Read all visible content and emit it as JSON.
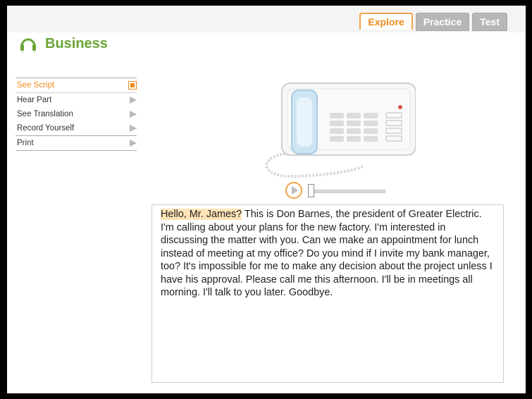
{
  "tabs": [
    {
      "label": "Explore",
      "active": true
    },
    {
      "label": "Practice",
      "active": false
    },
    {
      "label": "Test",
      "active": false
    }
  ],
  "header": {
    "title": "Business",
    "icon": "headphones-icon"
  },
  "menu": {
    "items": [
      {
        "label": "See Script",
        "icon": "stop-icon"
      },
      {
        "label": "Hear Part",
        "icon": "arrow-right-icon"
      },
      {
        "label": "See Translation",
        "icon": "arrow-right-icon"
      },
      {
        "label": "Record Yourself",
        "icon": "arrow-right-icon"
      },
      {
        "label": "Print",
        "icon": "arrow-right-icon"
      }
    ]
  },
  "player": {
    "progress": 0
  },
  "script": {
    "highlight": "Hello, Mr. James?",
    "rest": " This is Don Barnes, the president of Greater Electric. I'm calling about your plans for the new factory. I'm interested in discussing the matter with you. Can we make an appointment for lunch instead of meeting at my office? Do you mind if I invite my bank manager, too? It's impossible for me to make any decision about the project unless I have his approval. Please call me this afternoon. I'll be in meetings all morning. I'll talk to you later. Goodbye."
  },
  "colors": {
    "accent": "#f08a1c",
    "title": "#6aa536",
    "highlight": "#fde3b5"
  }
}
